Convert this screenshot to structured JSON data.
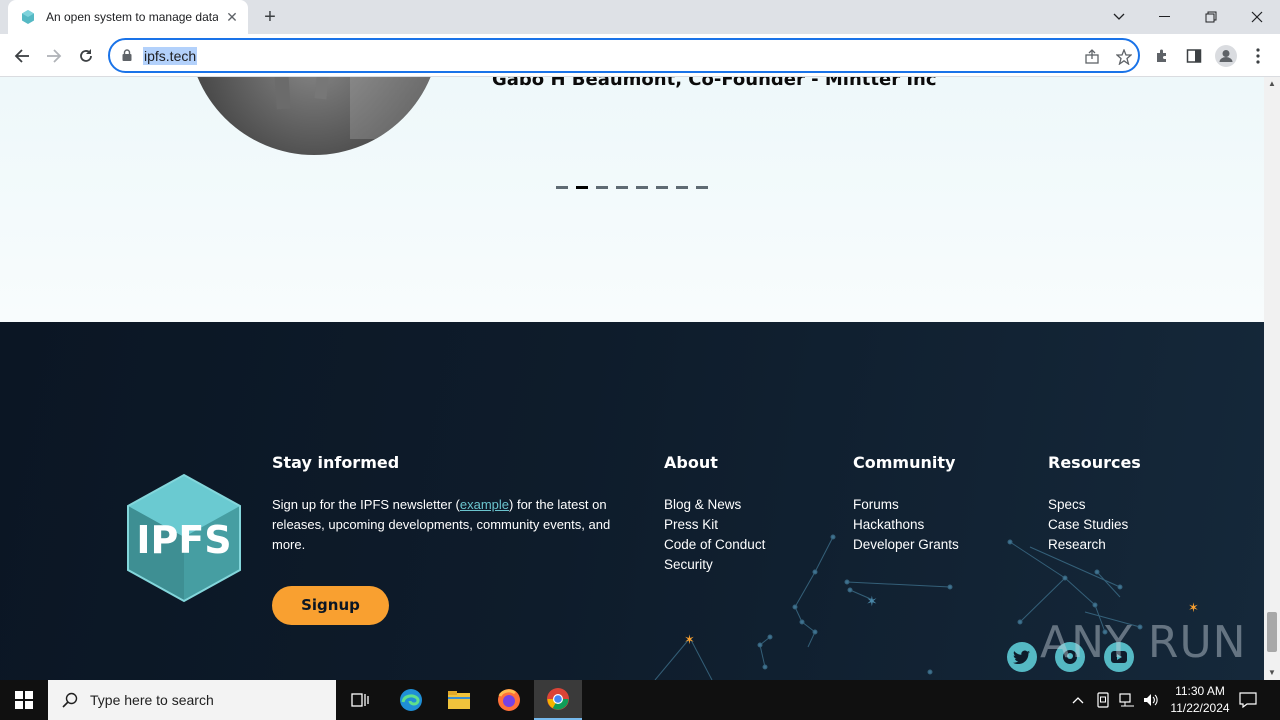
{
  "browser": {
    "tab_title": "An open system to manage data",
    "url": "ipfs.tech"
  },
  "testimonial": {
    "author": "Gabo H Beaumont, Co-Founder - Mintter Inc",
    "dots_count": 8,
    "active_dot_index": 1
  },
  "footer": {
    "stay_informed": {
      "heading": "Stay informed",
      "text_before": "Sign up for the IPFS newsletter (",
      "link": "example",
      "text_after": ") for the latest on releases, upcoming developments, community events, and more.",
      "button": "Signup"
    },
    "logo_text": "IPFS",
    "columns": [
      {
        "heading": "About",
        "links": [
          "Blog & News",
          "Press Kit",
          "Code of Conduct",
          "Security"
        ]
      },
      {
        "heading": "Community",
        "links": [
          "Forums",
          "Hackathons",
          "Developer Grants"
        ]
      },
      {
        "heading": "Resources",
        "links": [
          "Specs",
          "Case Studies",
          "Research"
        ]
      }
    ],
    "watermark": "ANY RUN"
  },
  "taskbar": {
    "search_placeholder": "Type here to search",
    "time": "11:30 AM",
    "date": "11/22/2024"
  },
  "colors": {
    "accent_orange": "#f9a030",
    "ipfs_teal": "#55b9c4",
    "footer_bg": "#0e1c2b",
    "omnibox_border": "#1a73e8"
  }
}
